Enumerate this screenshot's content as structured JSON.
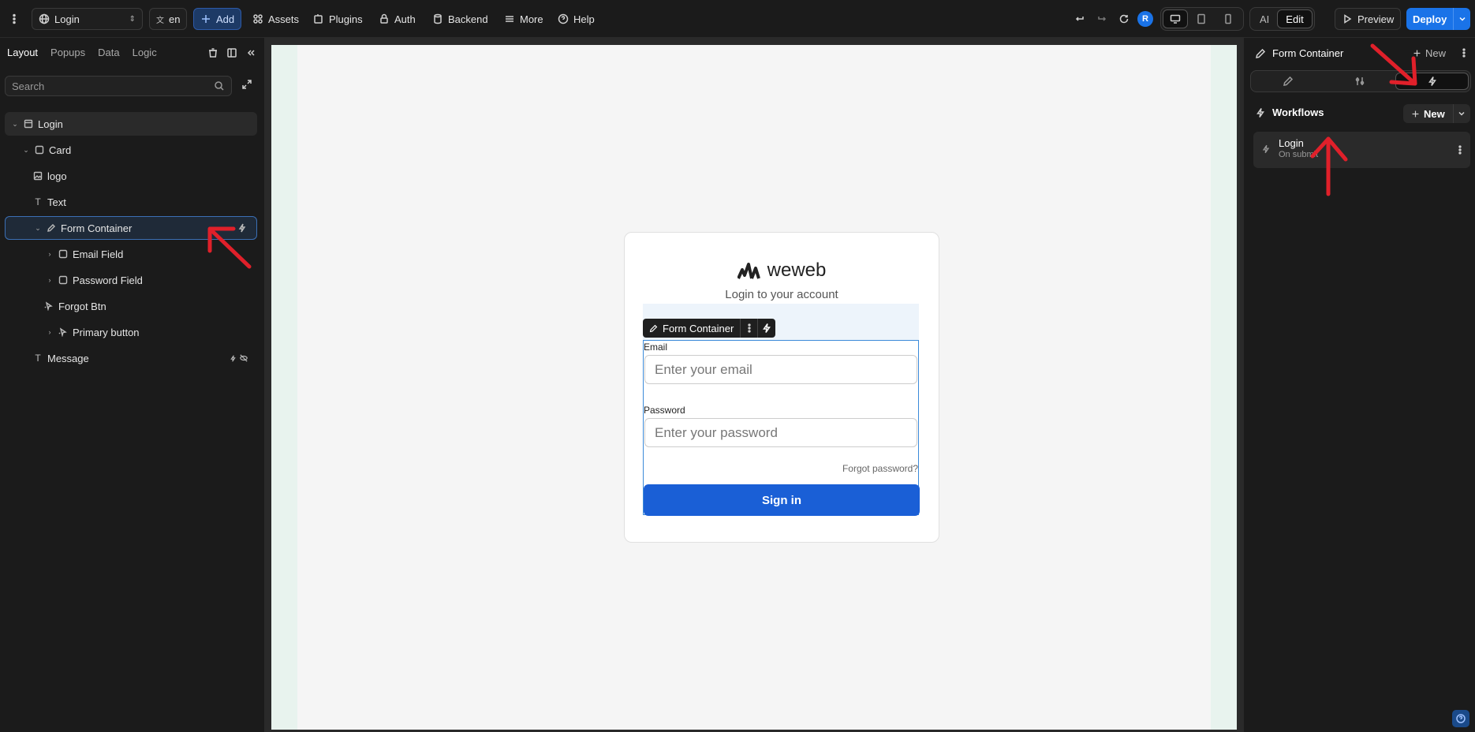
{
  "topbar": {
    "page_select": "Login",
    "lang": "en",
    "add": "Add",
    "assets": "Assets",
    "plugins": "Plugins",
    "auth": "Auth",
    "backend": "Backend",
    "more": "More",
    "help": "Help",
    "avatar": "R",
    "mode_ai": "AI",
    "mode_edit": "Edit",
    "preview": "Preview",
    "deploy": "Deploy"
  },
  "left": {
    "tabs": [
      "Layout",
      "Popups",
      "Data",
      "Logic"
    ],
    "search_placeholder": "Search",
    "tree": [
      {
        "label": "Login",
        "icon": "page-icon",
        "depth": 0,
        "expanded": true
      },
      {
        "label": "Card",
        "icon": "box-icon",
        "depth": 1,
        "expanded": true
      },
      {
        "label": "logo",
        "icon": "image-icon",
        "depth": 2
      },
      {
        "label": "Text",
        "icon": "text-icon",
        "depth": 2
      },
      {
        "label": "Form Container",
        "icon": "pencil-icon",
        "depth": 2,
        "expanded": true,
        "selected": true
      },
      {
        "label": "Email Field",
        "icon": "box-icon",
        "depth": 3,
        "collapsed": true
      },
      {
        "label": "Password Field",
        "icon": "box-icon",
        "depth": 3,
        "collapsed": true
      },
      {
        "label": "Forgot Btn",
        "icon": "cursor-icon",
        "depth": 2
      },
      {
        "label": "Primary button",
        "icon": "cursor-icon",
        "depth": 3,
        "collapsed": true
      },
      {
        "label": "Message",
        "icon": "text-icon",
        "depth": 1
      }
    ]
  },
  "canvas": {
    "logo_text": "weweb",
    "title": "Login to your account",
    "toolbar_label": "Form Container",
    "email_label": "Email",
    "email_placeholder": "Enter your email",
    "password_label": "Password",
    "password_placeholder": "Enter your password",
    "forgot": "Forgot password?",
    "signin": "Sign in"
  },
  "right": {
    "header": "Form Container",
    "new": "New",
    "workflows_title": "Workflows",
    "workflows_new": "New",
    "workflow": {
      "name": "Login",
      "trigger": "On submit"
    }
  },
  "colors": {
    "accent": "#1a73e8",
    "signin": "#1a5fd6",
    "annotation": "#e0202a"
  }
}
